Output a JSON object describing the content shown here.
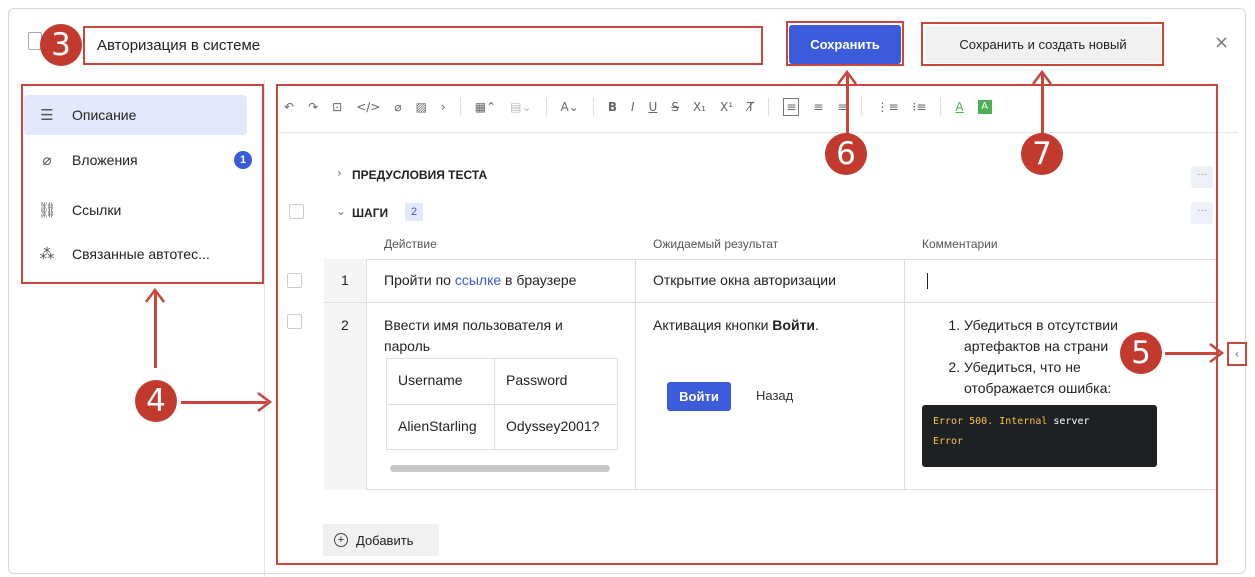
{
  "header": {
    "title_value": "Авторизация в системе",
    "save_label": "Сохранить",
    "save_new_label": "Сохранить и создать новый",
    "close_glyph": "×"
  },
  "sidebar": {
    "items": [
      {
        "label": "Описание",
        "icon": "list-icon",
        "active": true
      },
      {
        "label": "Вложения",
        "icon": "paperclip-icon",
        "badge": "1"
      },
      {
        "label": "Ссылки",
        "icon": "link-icon"
      },
      {
        "label": "Связанные автотес...",
        "icon": "autotest-icon"
      }
    ]
  },
  "sections": {
    "preconditions": "ПРЕДУСЛОВИЯ ТЕСТА",
    "steps": "ШАГИ",
    "steps_count": "2"
  },
  "table": {
    "headers": [
      "Действие",
      "Ожидаемый результат",
      "Комментарии"
    ],
    "rows": [
      {
        "num": "1",
        "action_pre": "Пройти по ",
        "action_link": "ссылке",
        "action_post": " в браузере",
        "expected": "Открытие окна авторизации",
        "comment": ""
      },
      {
        "num": "2",
        "action": "Ввести имя пользователя и пароль",
        "inner_table": [
          [
            "Username",
            "Password"
          ],
          [
            "AlienStarling",
            "Odyssey2001?"
          ]
        ],
        "expected_pre": "Активация кнопки ",
        "expected_bold": "Войти",
        "expected_post": ".",
        "login_label": "Войти",
        "back_label": "Назад",
        "comment_items": [
          "Убедиться в отсутствии артефактов на страни",
          "Убедиться, что не отображается ошибка:"
        ],
        "code_line1_a": "Error 500. Internal",
        "code_line1_b": " server",
        "code_line2": "Error"
      }
    ]
  },
  "add_label": "Добавить",
  "markers": [
    "3",
    "4",
    "5",
    "6",
    "7"
  ],
  "colors": {
    "accent": "#3b5bdb",
    "annotation": "#c8463c"
  }
}
